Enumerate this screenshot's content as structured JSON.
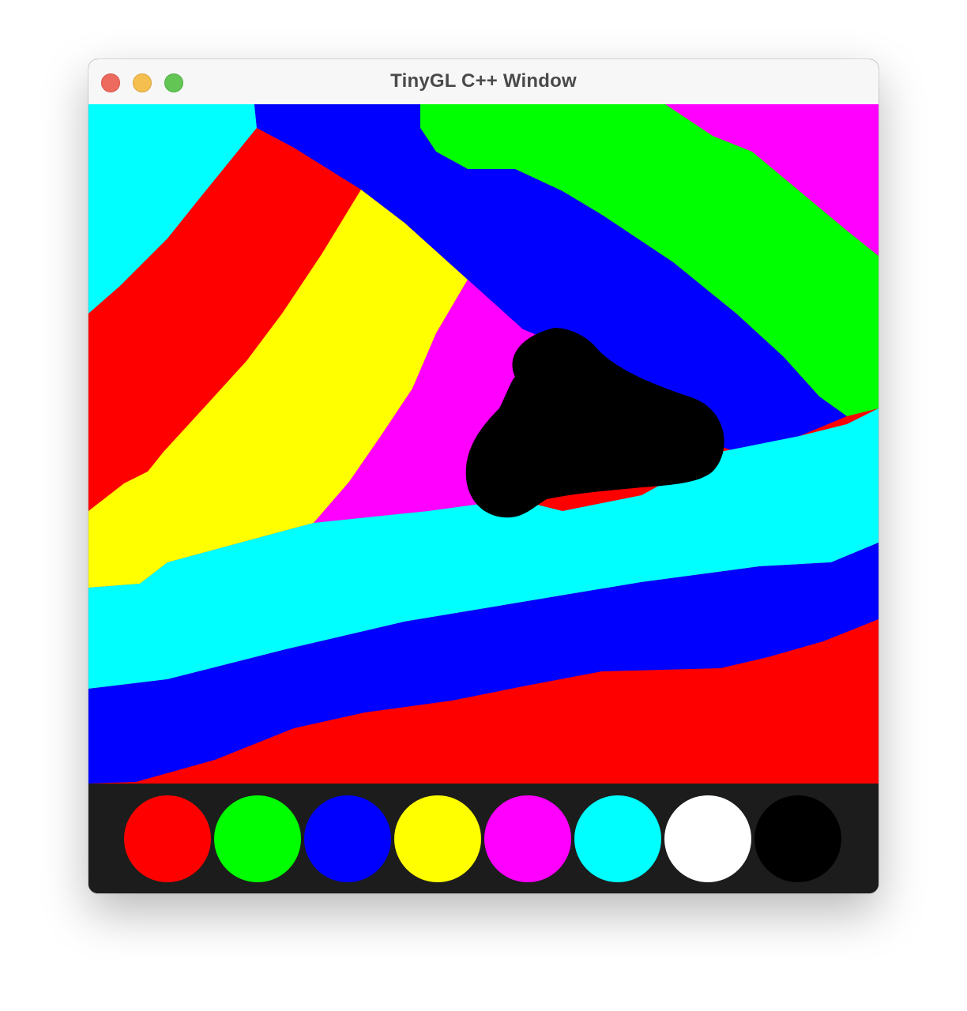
{
  "window": {
    "title": "TinyGL C++ Window"
  },
  "canvas": {
    "background": "#ff0000",
    "strokes": [
      {
        "name": "stroke-cyan-top-left",
        "color": "#00ffff"
      },
      {
        "name": "stroke-red-diagonal",
        "color": "#ff0000"
      },
      {
        "name": "stroke-yellow-diagonal",
        "color": "#ffff00"
      },
      {
        "name": "stroke-magenta-top-right",
        "color": "#ff00ff"
      },
      {
        "name": "stroke-green-diagonal",
        "color": "#00ff00"
      },
      {
        "name": "stroke-blue-diagonal",
        "color": "#0000ff"
      },
      {
        "name": "stroke-magenta-center",
        "color": "#ff00ff"
      },
      {
        "name": "stroke-cyan-horizontal",
        "color": "#00ffff"
      },
      {
        "name": "stroke-blue-horizontal",
        "color": "#0000ff"
      },
      {
        "name": "stroke-black-blob",
        "color": "#000000"
      }
    ]
  },
  "palette": {
    "colors": [
      {
        "name": "red",
        "hex": "#ff0000"
      },
      {
        "name": "green",
        "hex": "#00ff00"
      },
      {
        "name": "blue",
        "hex": "#0000ff"
      },
      {
        "name": "yellow",
        "hex": "#ffff00"
      },
      {
        "name": "magenta",
        "hex": "#ff00ff"
      },
      {
        "name": "cyan",
        "hex": "#00ffff"
      },
      {
        "name": "white",
        "hex": "#ffffff"
      },
      {
        "name": "black",
        "hex": "#000000"
      }
    ]
  }
}
